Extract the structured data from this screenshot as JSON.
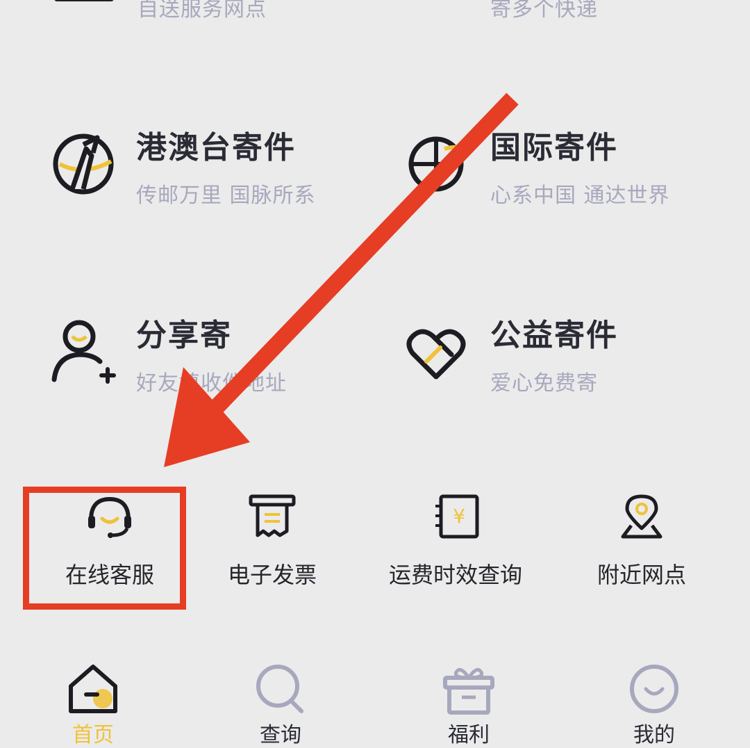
{
  "top_partial": {
    "left_sub": "自送服务网点",
    "right_sub": "寄多个快递"
  },
  "services": [
    {
      "title": "港澳台寄件",
      "subtitle": "传邮万里 国脉所系",
      "icon": "hk-macau-taiwan-icon"
    },
    {
      "title": "国际寄件",
      "subtitle": "心系中国 通达世界",
      "icon": "globe-icon"
    },
    {
      "title": "分享寄",
      "subtitle": "好友填收件地址",
      "icon": "user-plus-icon"
    },
    {
      "title": "公益寄件",
      "subtitle": "爱心免费寄",
      "icon": "heart-icon"
    }
  ],
  "quick_actions": [
    {
      "label": "在线客服",
      "icon": "headset-icon"
    },
    {
      "label": "电子发票",
      "icon": "receipt-icon"
    },
    {
      "label": "运费时效查询",
      "icon": "yuan-ledger-icon"
    },
    {
      "label": "附近网点",
      "icon": "location-pin-icon"
    }
  ],
  "tabbar": [
    {
      "label": "首页",
      "icon": "home-icon",
      "active": true
    },
    {
      "label": "查询",
      "icon": "search-icon",
      "active": false
    },
    {
      "label": "福利",
      "icon": "gift-icon",
      "active": false
    },
    {
      "label": "我的",
      "icon": "smile-user-icon",
      "active": false
    }
  ],
  "colors": {
    "background": "#ebebeb",
    "accent_yellow": "#f0c23a",
    "annotation_red": "#e63d25",
    "subtitle_gray": "#a7a8be",
    "title_dark": "#2b2b35"
  }
}
